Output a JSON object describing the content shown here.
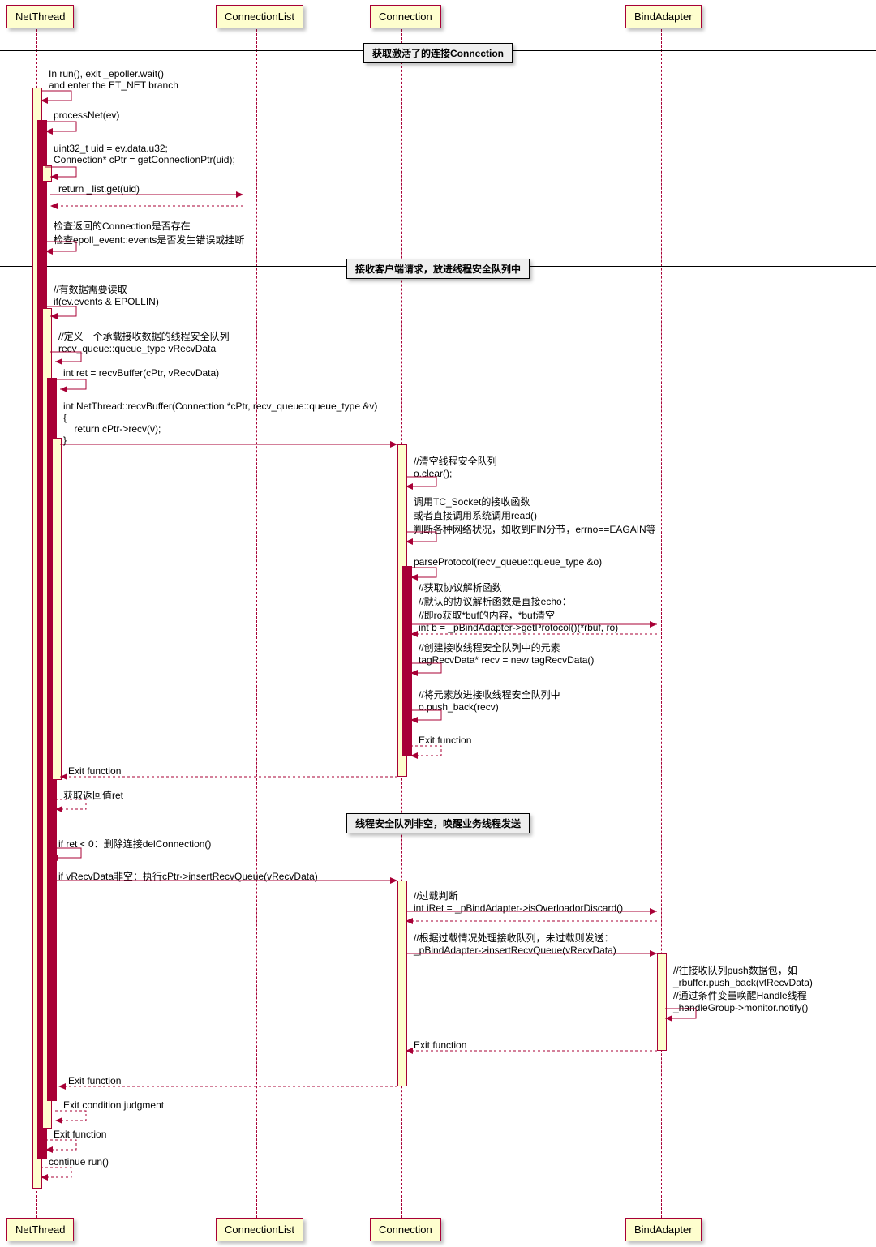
{
  "participants": {
    "net_thread": "NetThread",
    "connection_list": "ConnectionList",
    "connection": "Connection",
    "bind_adapter": "BindAdapter"
  },
  "dividers": {
    "d1": "获取激活了的连接Connection",
    "d2": "接收客户端请求，放进线程安全队列中",
    "d3": "线程安全队列非空，唤醒业务线程发送"
  },
  "messages": {
    "m1": "In run(), exit _epoller.wait()\nand enter the ET_NET branch",
    "m2": "processNet(ev)",
    "m3": "uint32_t uid = ev.data.u32;\nConnection* cPtr = getConnectionPtr(uid);",
    "m4": "return _list.get(uid)",
    "m5": "检查返回的Connection是否存在\n检查epoll_event::events是否发生错误或挂断",
    "m6": "//有数据需要读取\nif(ev.events & EPOLLIN)",
    "m7": "//定义一个承载接收数据的线程安全队列\nrecv_queue::queue_type vRecvData",
    "m8": "int ret = recvBuffer(cPtr, vRecvData)",
    "m9": "int NetThread::recvBuffer(Connection *cPtr, recv_queue::queue_type &v)\n{\n    return cPtr->recv(v);\n}",
    "m10": "//清空线程安全队列\no.clear();",
    "m11": "调用TC_Socket的接收函数\n或者直接调用系统调用read()\n判断各种网络状况，如收到FIN分节，errno==EAGAIN等",
    "m12": "parseProtocol(recv_queue::queue_type &o)",
    "m13": "//获取协议解析函数\n//默认的协议解析函数是直接echo：\n//即ro获取*buf的内容，*buf清空\nint b = _pBindAdapter->getProtocol()(*rbuf, ro)",
    "m14": "//创建接收线程安全队列中的元素\ntagRecvData* recv = new tagRecvData()",
    "m15": "//将元素放进接收线程安全队列中\no.push_back(recv)",
    "m16": "Exit function",
    "m17": "Exit function",
    "m18": "获取返回值ret",
    "m19": "if ret < 0：删除连接delConnection()",
    "m20": "if vRecvData非空：执行cPtr->insertRecvQueue(vRecvData)",
    "m21": "//过载判断\nint iRet = _pBindAdapter->isOverloadorDiscard()",
    "m22": "//根据过载情况处理接收队列，未过载则发送：\n_pBindAdapter->insertRecvQueue(vRecvData)",
    "m23": "//往接收队列push数据包，如\n_rbuffer.push_back(vtRecvData)\n//通过条件变量唤醒Handle线程\n_handleGroup->monitor.notify()",
    "m24": "Exit function",
    "m25": "Exit function",
    "m26": "Exit condition judgment",
    "m27": "Exit function",
    "m28": "continue run()"
  },
  "geom": {
    "lanes": {
      "nt": 45,
      "cl": 316,
      "cn": 495,
      "ba": 815
    }
  }
}
